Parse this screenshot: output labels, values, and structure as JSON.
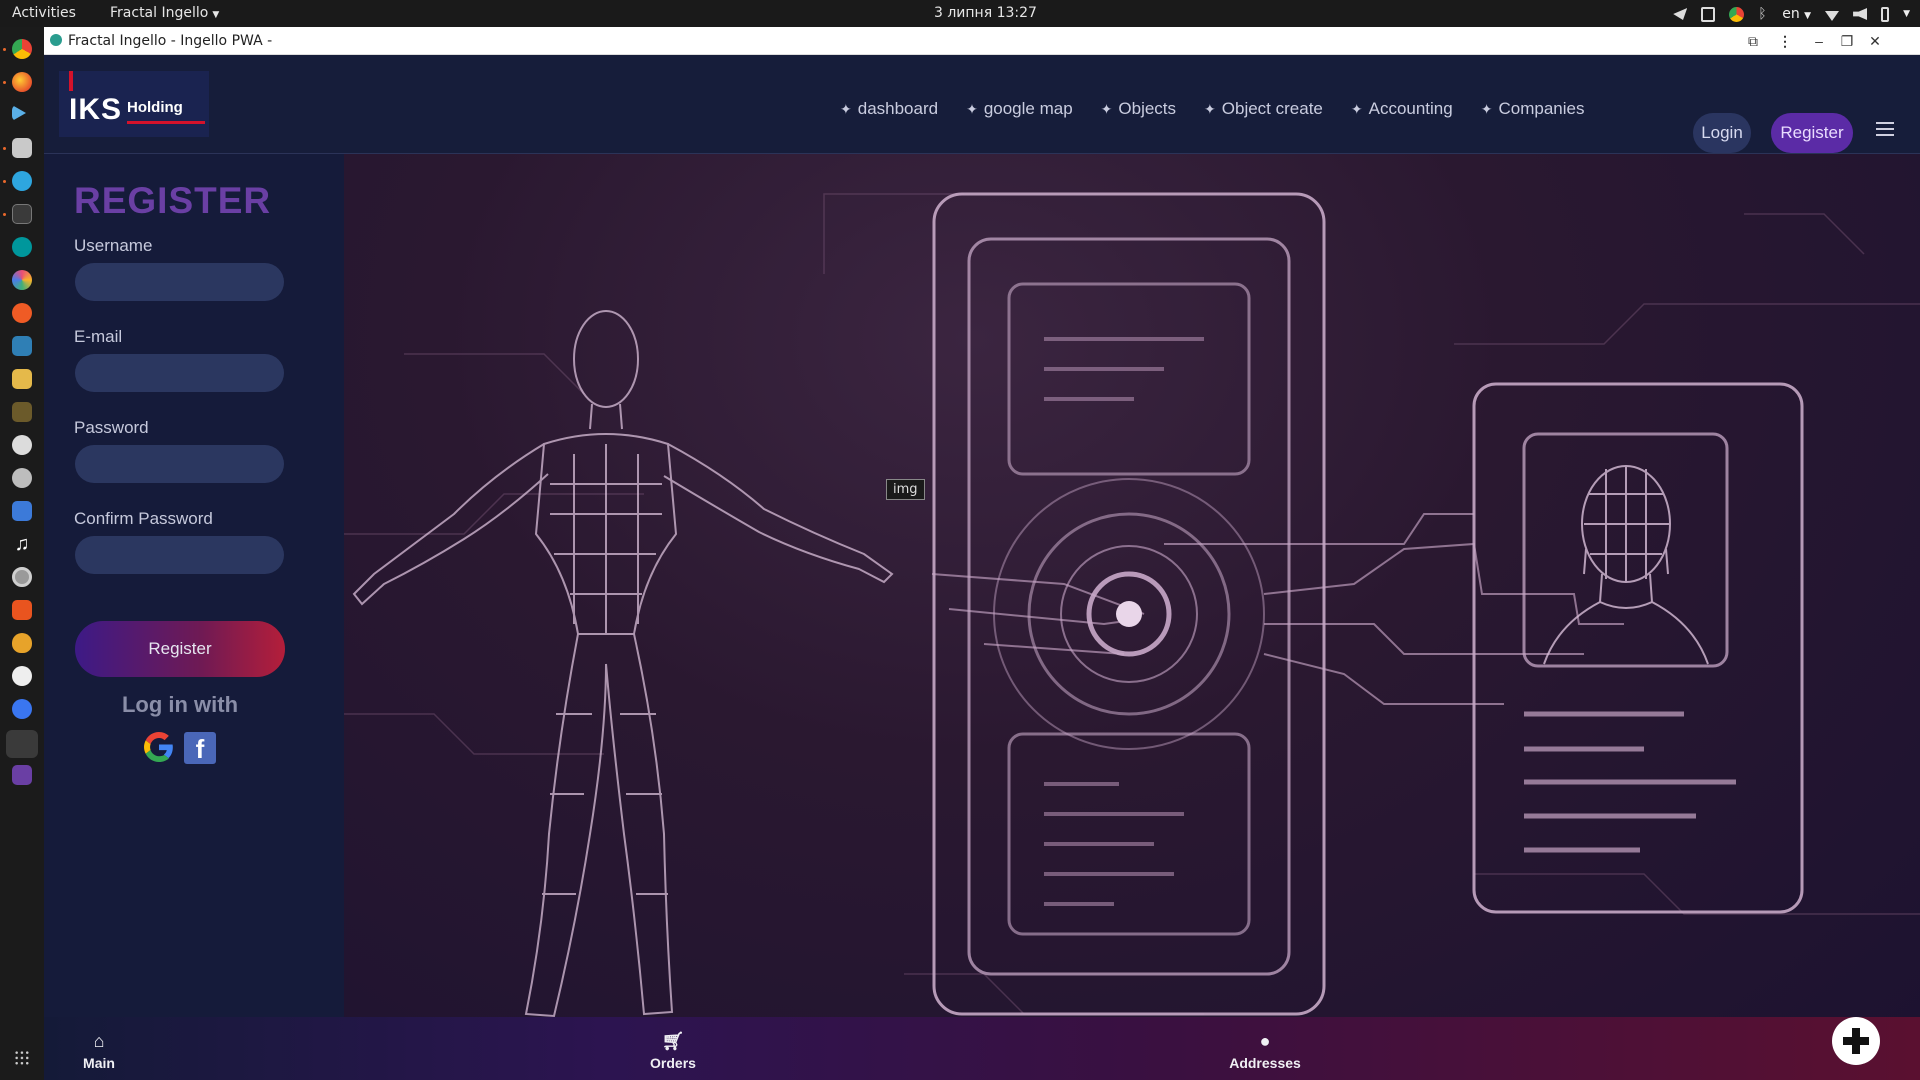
{
  "system_bar": {
    "activities": "Activities",
    "app_name": "Fractal Ingello",
    "clock": "3 липня  13:27",
    "lang": "en"
  },
  "browser": {
    "title": "Fractal Ingello - Ingello PWA -"
  },
  "header": {
    "logo_main": "IKS",
    "logo_sub": "Holding",
    "nav": [
      {
        "label": "dashboard"
      },
      {
        "label": "google map"
      },
      {
        "label": "Objects"
      },
      {
        "label": "Object create"
      },
      {
        "label": "Accounting"
      },
      {
        "label": "Companies"
      }
    ],
    "nav_prefix": "✦",
    "login_label": "Login",
    "register_label": "Register"
  },
  "form": {
    "title": "REGISTER",
    "username_label": "Username",
    "email_label": "E-mail",
    "password_label": "Password",
    "confirm_label": "Confirm Password",
    "submit_label": "Register",
    "login_with": "Log in with",
    "facebook_glyph": "f"
  },
  "hero": {
    "img_tooltip": "img"
  },
  "bottom_nav": {
    "main": "Main",
    "orders": "Orders",
    "addresses": "Addresses"
  },
  "colors": {
    "accent_purple": "#6a3fa4",
    "panel_bg": "#151b3a",
    "input_bg": "#2b3760",
    "facebook": "#4a67b8"
  }
}
